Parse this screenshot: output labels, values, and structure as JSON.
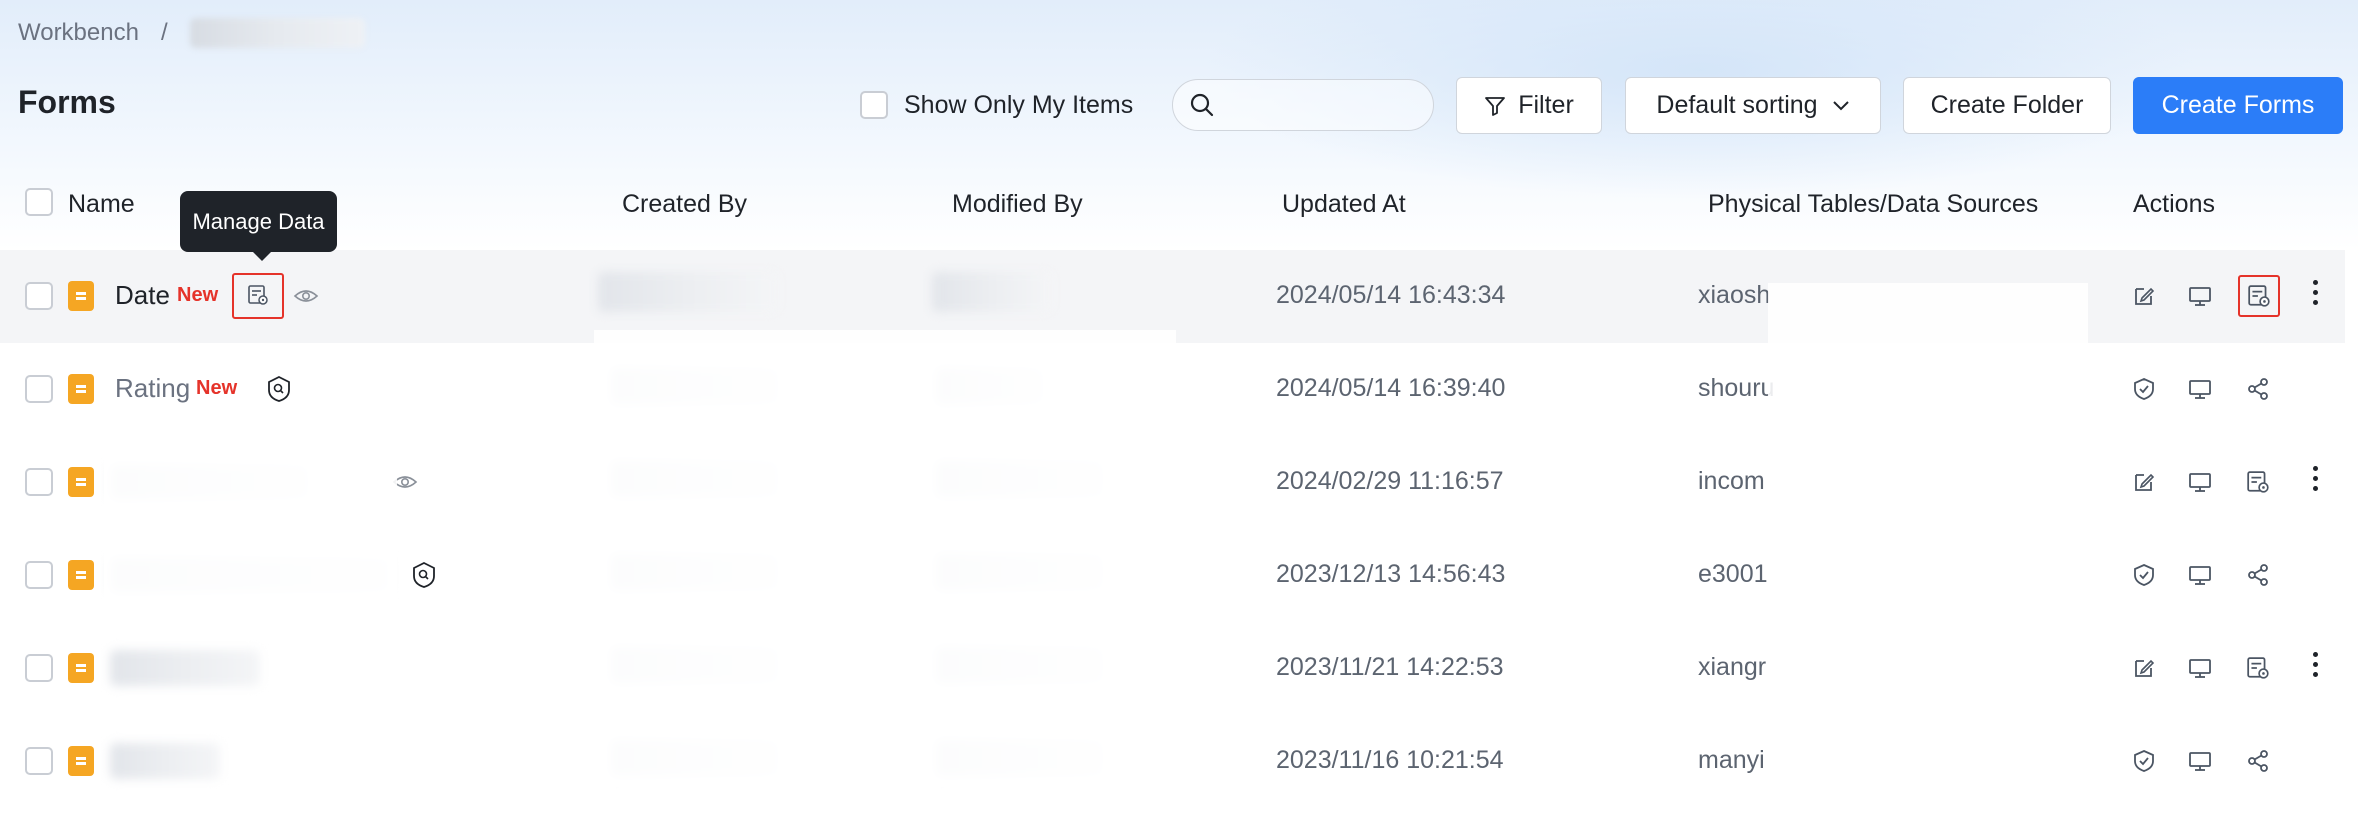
{
  "breadcrumb": {
    "root": "Workbench",
    "separator": "/"
  },
  "page": {
    "title": "Forms"
  },
  "toolbar": {
    "show_only_mine_label": "Show Only My Items",
    "search_placeholder": "",
    "filter_label": "Filter",
    "sort_label": "Default sorting",
    "create_folder_label": "Create Folder",
    "create_forms_label": "Create Forms"
  },
  "tooltip": {
    "text": "Manage Data"
  },
  "table": {
    "columns": {
      "name": "Name",
      "created_by": "Created By",
      "modified_by": "Modified By",
      "updated_at": "Updated At",
      "physical_tables": "Physical Tables/Data Sources",
      "actions": "Actions"
    },
    "rows": [
      {
        "name": "Date",
        "badge": "New",
        "updated_at": "2024/05/14 16:43:34",
        "physical": "xiaosh"
      },
      {
        "name": "Rating",
        "badge": "New",
        "updated_at": "2024/05/14 16:39:40",
        "physical": "shouru"
      },
      {
        "name": "",
        "badge": "",
        "updated_at": "2024/02/29 11:16:57",
        "physical": "incom"
      },
      {
        "name": "",
        "badge": "",
        "updated_at": "2023/12/13 14:56:43",
        "physical": "e3001"
      },
      {
        "name": "",
        "badge": "",
        "updated_at": "2023/11/21 14:22:53",
        "physical": "xiangr"
      },
      {
        "name": "",
        "badge": "",
        "updated_at": "2023/11/16 10:21:54",
        "physical": "manyi"
      }
    ]
  },
  "colors": {
    "primary": "#2b7df8",
    "new_badge": "#e5332a",
    "form_icon": "#f5a623",
    "highlight_box": "#e5332a"
  }
}
